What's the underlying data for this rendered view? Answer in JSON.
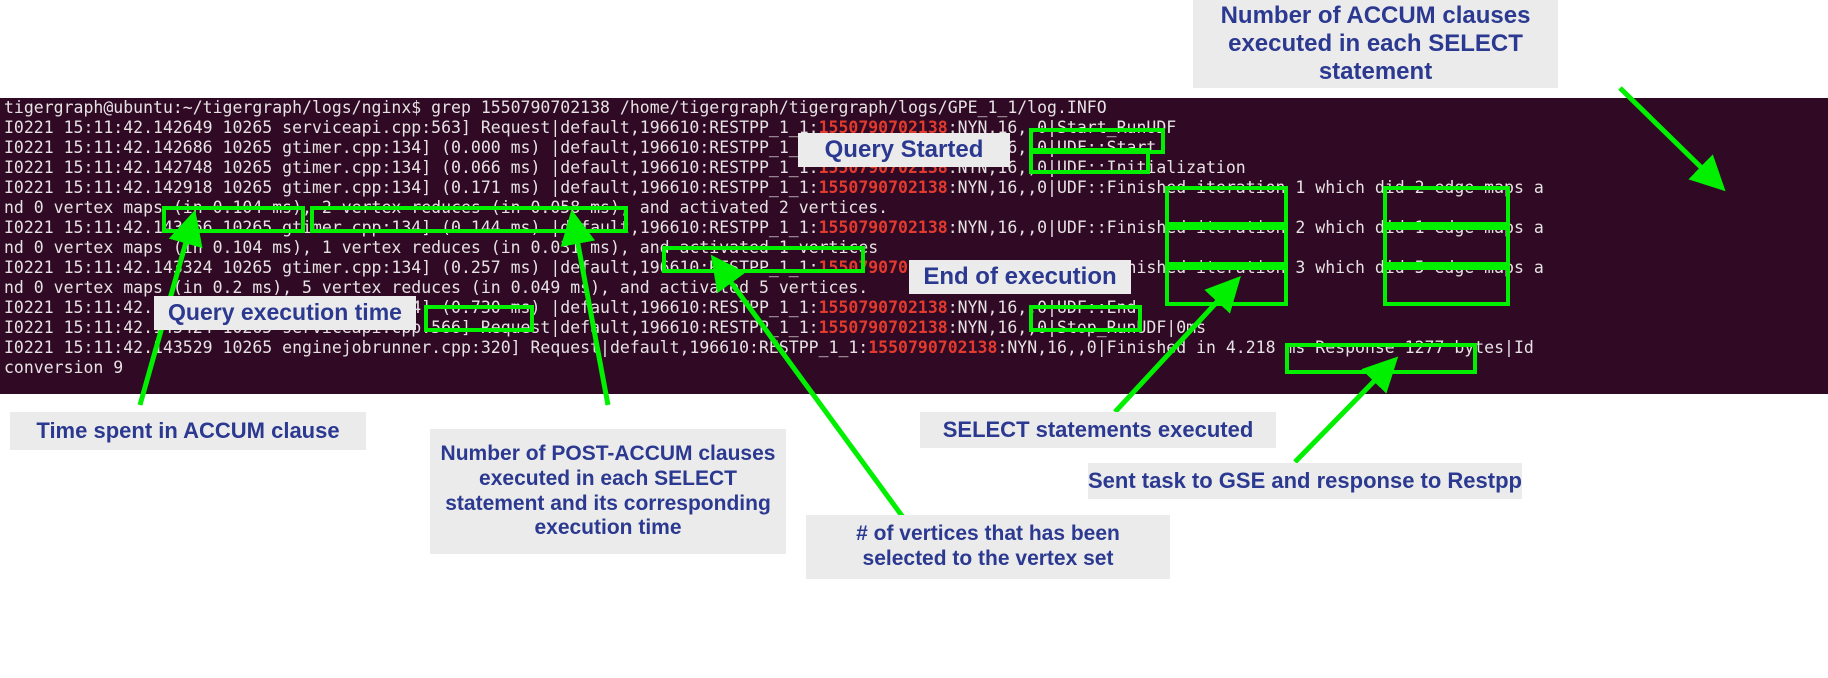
{
  "terminal": {
    "background_color": "#300a24",
    "text_color": "#e6e2e4",
    "timestamp_highlight_color": "#e33a2e",
    "highlight_token": "1550790702138",
    "lines": [
      "tigergraph@ubuntu:~/tigergraph/logs/nginx$ grep 1550790702138 /home/tigergraph/tigergraph/logs/GPE_1_1/log.INFO",
      "I0221 15:11:42.142649 10265 serviceapi.cpp:563] Request|default,196610:RESTPP_1_1:1550790702138:NYN,16,,0|Start_RunUDF",
      "I0221 15:11:42.142686 10265 gtimer.cpp:134] (0.000 ms) |default,196610:RESTPP_1_1:1550790702138:NYN,16,,0|UDF::Start",
      "I0221 15:11:42.142748 10265 gtimer.cpp:134] (0.066 ms) |default,196610:RESTPP_1_1:1550790702138:NYN,16,,0|UDF::Initialization",
      "I0221 15:11:42.142918 10265 gtimer.cpp:134] (0.171 ms) |default,196610:RESTPP_1_1:1550790702138:NYN,16,,0|UDF::Finished iteration 1 which did 2 edge maps a",
      "nd 0 vertex maps (in 0.104 ms), 2 vertex reduces (in 0.058 ms), and activated 2 vertices.",
      "I0221 15:11:42.143066 10265 gtimer.cpp:134] (0.144 ms) |default,196610:RESTPP_1_1:1550790702138:NYN,16,,0|UDF::Finished iteration 2 which did 1 edge maps a",
      "nd 0 vertex maps (in 0.104 ms), 1 vertex reduces (in 0.031 ms), and activated 1 vertices",
      "I0221 15:11:42.143324 10265 gtimer.cpp:134] (0.257 ms) |default,196610:RESTPP_1_1:1550790702138:NYN,16,,0|UDF::Finished iteration 3 which did 5 edge maps a",
      "nd 0 vertex maps (in 0.2 ms), 5 vertex reduces (in 0.049 ms), and activated 5 vertices.",
      "I0221 15:11:42.143400 10265 gtimer.cpp:134] (0.730 ms) |default,196610:RESTPP_1_1:1550790702138:NYN,16,,0|UDF::End",
      "I0221 15:11:42.143424 10265 serviceapi.cpp:566] Request|default,196610:RESTPP_1_1:1550790702138:NYN,16,,0|Stop_RunUDF|0ms",
      "I0221 15:11:42.143529 10265 enginejobrunner.cpp:320] Request|default,196610:RESTPP_1_1:1550790702138:NYN,16,,0|Finished in 4.218 ms Response 1277 bytes|Id",
      "conversion 9"
    ]
  },
  "callouts": [
    {
      "id": "accum-clauses",
      "text": "Number of ACCUM clauses executed in each SELECT statement"
    },
    {
      "id": "query-started",
      "text": "Query Started"
    },
    {
      "id": "end-of-execution",
      "text": "End of execution"
    },
    {
      "id": "query-execution-time",
      "text": "Query execution time"
    },
    {
      "id": "time-in-accum",
      "text": "Time spent in ACCUM clause"
    },
    {
      "id": "post-accum-clauses",
      "text": "Number of POST-ACCUM clauses executed in each SELECT statement and its corresponding execution time"
    },
    {
      "id": "vertices-selected",
      "text": "# of vertices that has been selected to the vertex set"
    },
    {
      "id": "select-statements",
      "text": "SELECT statements executed"
    },
    {
      "id": "sent-task-gse",
      "text": "Sent task to GSE and response to Restpp"
    }
  ],
  "highlight_boxes": [
    {
      "id": "box-start-runudf",
      "label": "|Start_RunUDF"
    },
    {
      "id": "box-udf-start",
      "label": "|UDF::Start"
    },
    {
      "id": "box-in-0-104-ms",
      "label": "(in 0.104 ms)"
    },
    {
      "id": "box-vertex-reduces",
      "label": "2 vertex reduces (in 0.058 ms),"
    },
    {
      "id": "box-iteration-1",
      "label": "iteration 1"
    },
    {
      "id": "box-2-edge-maps",
      "label": "2 edge maps"
    },
    {
      "id": "box-iteration-2",
      "label": "iteration 2"
    },
    {
      "id": "box-1-edge-maps",
      "label": "1 edge maps"
    },
    {
      "id": "box-activated-1",
      "label": "activated 1 vertices"
    },
    {
      "id": "box-iteration-3",
      "label": "iteration 3"
    },
    {
      "id": "box-5-edge-maps",
      "label": "5 edge maps"
    },
    {
      "id": "box-0-730-ms",
      "label": "(0.730 ms)"
    },
    {
      "id": "box-udf-end",
      "label": "|UDF::End"
    },
    {
      "id": "box-response-bytes",
      "label": "Response 1277 bytes"
    }
  ],
  "colors": {
    "annotation_green": "#00f000",
    "callout_text": "#2b3990",
    "callout_background": "#ebebeb",
    "terminal_background": "#300a24"
  }
}
